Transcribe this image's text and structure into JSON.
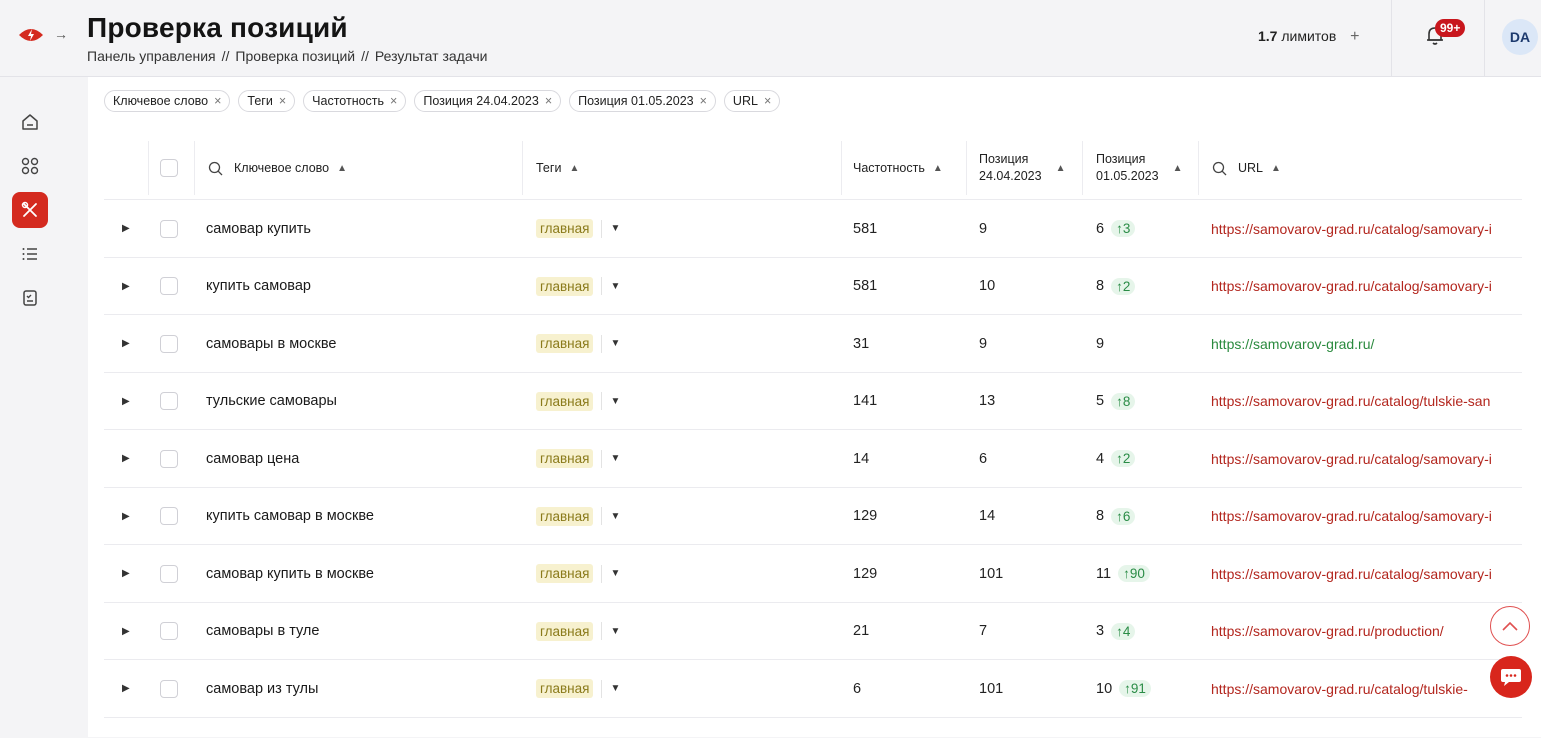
{
  "header": {
    "title": "Проверка позиций",
    "breadcrumbs": [
      "Панель управления",
      "Проверка позиций",
      "Результат задачи"
    ],
    "breadcrumb_sep": "//",
    "limits_value": "1.7",
    "limits_label": "лимитов",
    "limits_plus": "+",
    "notifications_badge": "99+",
    "avatar_initials": "DA"
  },
  "filters": [
    {
      "label": "Ключевое слово"
    },
    {
      "label": "Теги"
    },
    {
      "label": "Частотность"
    },
    {
      "label": "Позиция 24.04.2023"
    },
    {
      "label": "Позиция 01.05.2023"
    },
    {
      "label": "URL"
    }
  ],
  "columns": {
    "keyword": "Ключевое слово",
    "tags": "Теги",
    "frequency": "Частотность",
    "pos1_line1": "Позиция",
    "pos1_line2": "24.04.2023",
    "pos2_line1": "Позиция",
    "pos2_line2": "01.05.2023",
    "url": "URL"
  },
  "rows": [
    {
      "keyword": "самовар купить",
      "tag": "главная",
      "frequency": "581",
      "pos1": "9",
      "pos2": "6",
      "delta": "3",
      "url": "https://samovarov-grad.ru/catalog/samovary-i",
      "url_color": "red"
    },
    {
      "keyword": "купить самовар",
      "tag": "главная",
      "frequency": "581",
      "pos1": "10",
      "pos2": "8",
      "delta": "2",
      "url": "https://samovarov-grad.ru/catalog/samovary-i",
      "url_color": "red"
    },
    {
      "keyword": "самовары в москве",
      "tag": "главная",
      "frequency": "31",
      "pos1": "9",
      "pos2": "9",
      "delta": "",
      "url": "https://samovarov-grad.ru/",
      "url_color": "green"
    },
    {
      "keyword": "тульские самовары",
      "tag": "главная",
      "frequency": "141",
      "pos1": "13",
      "pos2": "5",
      "delta": "8",
      "url": "https://samovarov-grad.ru/catalog/tulskie-san",
      "url_color": "red"
    },
    {
      "keyword": "самовар цена",
      "tag": "главная",
      "frequency": "14",
      "pos1": "6",
      "pos2": "4",
      "delta": "2",
      "url": "https://samovarov-grad.ru/catalog/samovary-i",
      "url_color": "red"
    },
    {
      "keyword": "купить самовар в москве",
      "tag": "главная",
      "frequency": "129",
      "pos1": "14",
      "pos2": "8",
      "delta": "6",
      "url": "https://samovarov-grad.ru/catalog/samovary-i",
      "url_color": "red"
    },
    {
      "keyword": "самовар купить в москве",
      "tag": "главная",
      "frequency": "129",
      "pos1": "101",
      "pos2": "11",
      "delta": "90",
      "url": "https://samovarov-grad.ru/catalog/samovary-i",
      "url_color": "red"
    },
    {
      "keyword": "самовары в туле",
      "tag": "главная",
      "frequency": "21",
      "pos1": "7",
      "pos2": "3",
      "delta": "4",
      "url": "https://samovarov-grad.ru/production/",
      "url_color": "red"
    },
    {
      "keyword": "самовар из тулы",
      "tag": "главная",
      "frequency": "6",
      "pos1": "101",
      "pos2": "10",
      "delta": "91",
      "url": "https://samovarov-grad.ru/catalog/tulskie-",
      "url_color": "red"
    }
  ],
  "colors": {
    "accent": "#d42a1f",
    "tag_bg": "#f7f1cf",
    "delta_bg": "#e6f5ea",
    "delta_text": "#2a8c46",
    "url_red": "#b3261e",
    "url_green": "#2a8a3e"
  },
  "icons": {
    "sidebar": [
      "home-icon",
      "grid-icon",
      "tools-icon",
      "list-icon",
      "report-icon"
    ],
    "delta": "arrow-up-icon"
  }
}
